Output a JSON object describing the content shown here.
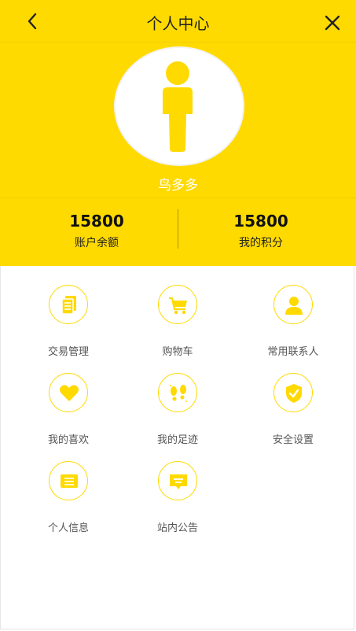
{
  "header": {
    "title": "个人中心",
    "username": "鸟多多",
    "back_icon": "chevron-left-icon",
    "close_icon": "close-icon",
    "avatar_icon": "person-icon"
  },
  "stats": [
    {
      "value": "15800",
      "label": "账户余额"
    },
    {
      "value": "15800",
      "label": "我的积分"
    }
  ],
  "menu": [
    {
      "label": "交易管理",
      "icon": "document-icon"
    },
    {
      "label": "购物车",
      "icon": "cart-icon"
    },
    {
      "label": "常用联系人",
      "icon": "contact-icon"
    },
    {
      "label": "我的喜欢",
      "icon": "heart-icon"
    },
    {
      "label": "我的足迹",
      "icon": "footprint-icon"
    },
    {
      "label": "安全设置",
      "icon": "shield-icon"
    },
    {
      "label": "个人信息",
      "icon": "id-card-icon"
    },
    {
      "label": "站内公告",
      "icon": "message-icon"
    }
  ],
  "colors": {
    "accent": "#FFDA00",
    "background": "#FFFFFF"
  }
}
